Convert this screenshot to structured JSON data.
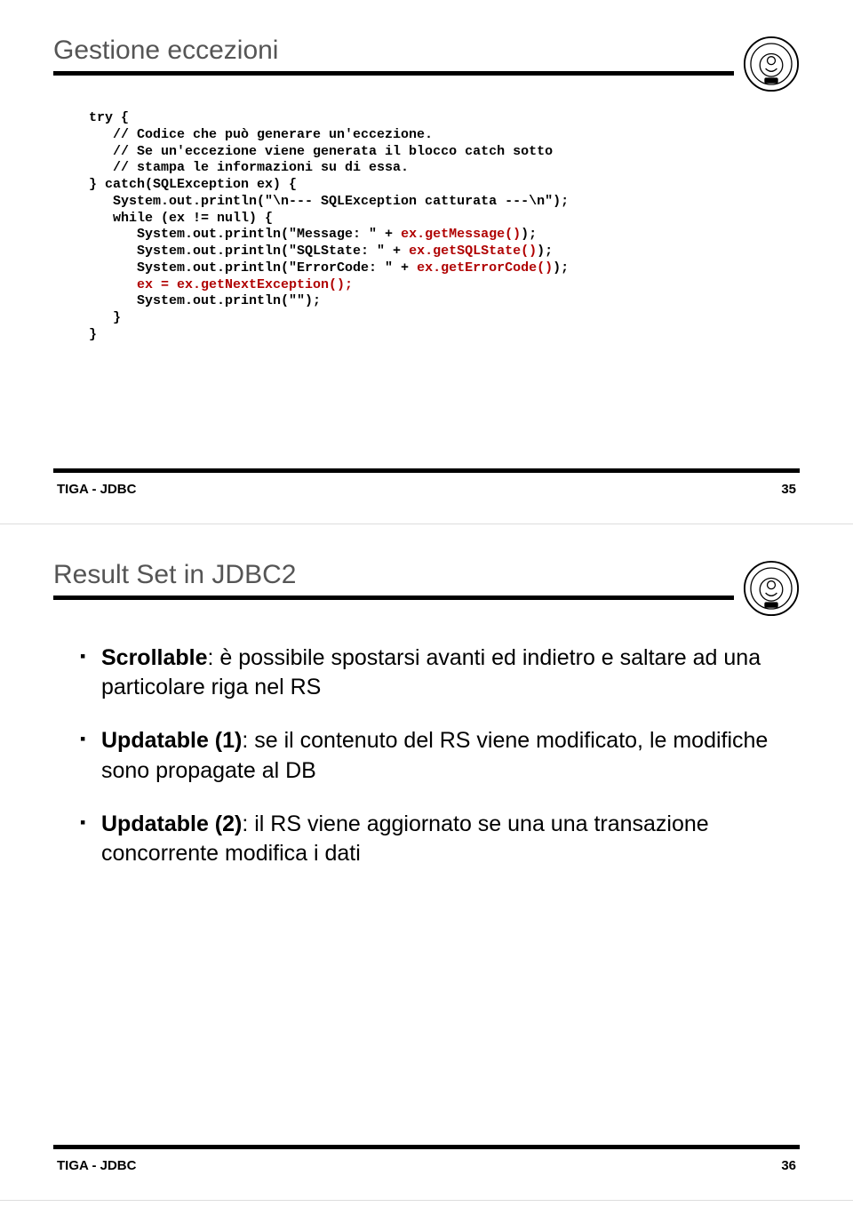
{
  "slide1": {
    "title": "Gestione eccezioni",
    "footer_left": "TIGA - JDBC",
    "footer_right": "35"
  },
  "slide2": {
    "title": "Result Set in JDBC2",
    "bullets": [
      {
        "bold": "Scrollable",
        "rest": ": è possibile spostarsi avanti ed indietro e saltare ad una particolare riga nel RS"
      },
      {
        "bold": "Updatable (1)",
        "rest": ": se il contenuto del RS viene modificato, le modifiche sono propagate al DB"
      },
      {
        "bold": "Updatable (2)",
        "rest": ": il RS viene aggiornato se una una transazione concorrente modifica i dati"
      }
    ],
    "footer_left": "TIGA - JDBC",
    "footer_right": "36"
  },
  "code": {
    "l01": "try {",
    "l02": "   // Codice che può generare un'eccezione.",
    "l03": "   // Se un'eccezione viene generata il blocco catch sotto",
    "l04": "   // stampa le informazioni su di essa.",
    "l05": "} catch(SQLException ex) {",
    "l06": "   System.out.println(\"\\n--- SQLException catturata ---\\n\");",
    "l07": "   while (ex != null) {",
    "l08a": "      System.out.println(\"Message: \" + ",
    "l08h": "ex.getMessage()",
    "l08b": ");",
    "l09a": "      System.out.println(\"SQLState: \" + ",
    "l09h": "ex.getSQLState()",
    "l09b": ");",
    "l10a": "      System.out.println(\"ErrorCode: \" + ",
    "l10h": "ex.getErrorCode()",
    "l10b": ");",
    "l11": "      ex = ex.getNextException();",
    "l12": "      System.out.println(\"\");",
    "l13": "   }",
    "l14": "}"
  }
}
